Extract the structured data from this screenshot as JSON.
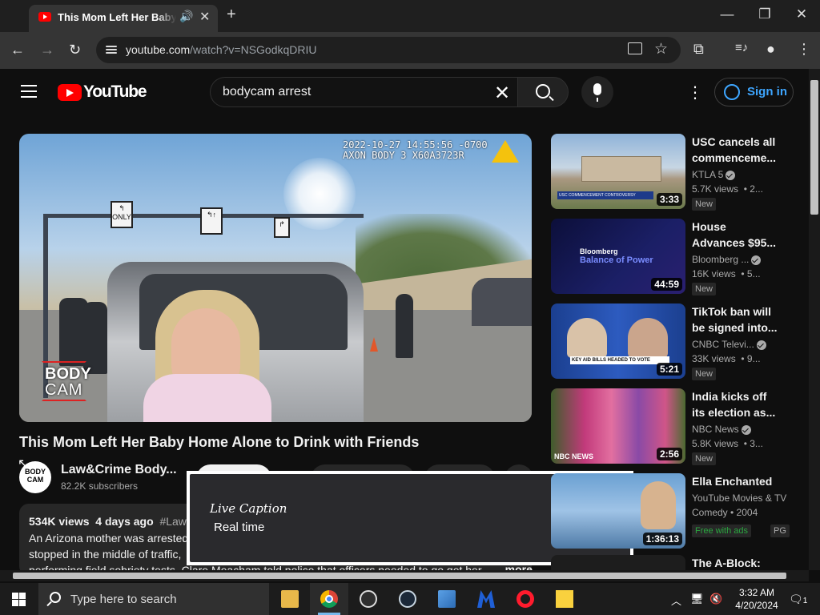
{
  "browser": {
    "tab_title": "This Mom Left Her Baby Home Alone to Drink with Friends",
    "url_host": "youtube.com",
    "url_path": "/watch?v=NSGodkqDRIU"
  },
  "icons": {
    "audio": "🔊",
    "close": "✕",
    "plus": "+",
    "minimize": "—",
    "restore": "❐",
    "back": "←",
    "forward": "→",
    "reload": "↻",
    "star": "☆",
    "extensions": "⧉",
    "media": "≡♪",
    "profile": "●",
    "menu": "⋮",
    "cursor": "↖"
  },
  "header": {
    "logo_text": "YouTube",
    "search_query": "bodycam arrest",
    "clear_icon": "✕",
    "more_icon": "⋮",
    "sign_in": "Sign in"
  },
  "player": {
    "cam_stamp": "2022-10-27 14:55:56 -0700\nAXON BODY 3 X60A3723R",
    "sign_left": "ONLY",
    "logo_line1": "BODY",
    "logo_line2": "CAM"
  },
  "video": {
    "title": "This Mom Left Her Baby Home Alone to Drink with Friends",
    "channel_avatar_text": "BODY CAM",
    "channel_name": "Law&Crime Body...",
    "subscribers": "82.2K subscribers"
  },
  "description": {
    "views": "534K views",
    "age": "4 days ago",
    "hashtag": "#Lawa",
    "line1": "An Arizona mother was arrested",
    "line2": "stopped in the middle of traffic,",
    "line3": "performing field sobriety tests. Clare Meacham told police that officers needed to go get her",
    "more": "...more"
  },
  "live_caption": {
    "title": "Live Caption",
    "text": "Real time"
  },
  "recommendations": [
    {
      "title": "USC cancels all commenceme...",
      "channel": "KTLA 5",
      "verified": true,
      "views": "5.7K views",
      "age": "• 2...",
      "badge": "New",
      "duration": "3:33",
      "thumb_banner": "USC COMMENCEMENT CONTROVERSY"
    },
    {
      "title": "House Advances $95...",
      "channel": "Bloomberg ...",
      "verified": true,
      "views": "16K views",
      "age": "• 5...",
      "badge": "New",
      "duration": "44:59",
      "thumb_brand": "Bloomberg",
      "thumb_show": "Balance of Power"
    },
    {
      "title": "TikTok ban will be signed into...",
      "channel": "CNBC Televi...",
      "verified": true,
      "views": "33K views",
      "age": "• 9...",
      "badge": "New",
      "duration": "5:21",
      "thumb_banner": "KEY AID BILLS HEADED TO VOTE"
    },
    {
      "title": "India kicks off its election as...",
      "channel": "NBC News",
      "verified": true,
      "views": "5.8K views",
      "age": "• 3...",
      "badge": "New",
      "duration": "2:56",
      "thumb_logo": "NBC NEWS"
    },
    {
      "title": "Ella Enchanted",
      "channel": "YouTube Movies & TV",
      "views": "Comedy • 2004",
      "badge": "Free with ads",
      "badge2": "PG",
      "duration": "1:36:13"
    },
    {
      "title": "The A-Block:"
    }
  ],
  "taskbar": {
    "search_placeholder": "Type here to search",
    "time": "3:32 AM",
    "date": "4/20/2024",
    "notifications": "1"
  },
  "colors": {
    "youtube_red": "#ff0000",
    "link_blue": "#3ea6ff",
    "free_green": "#2ba640"
  }
}
